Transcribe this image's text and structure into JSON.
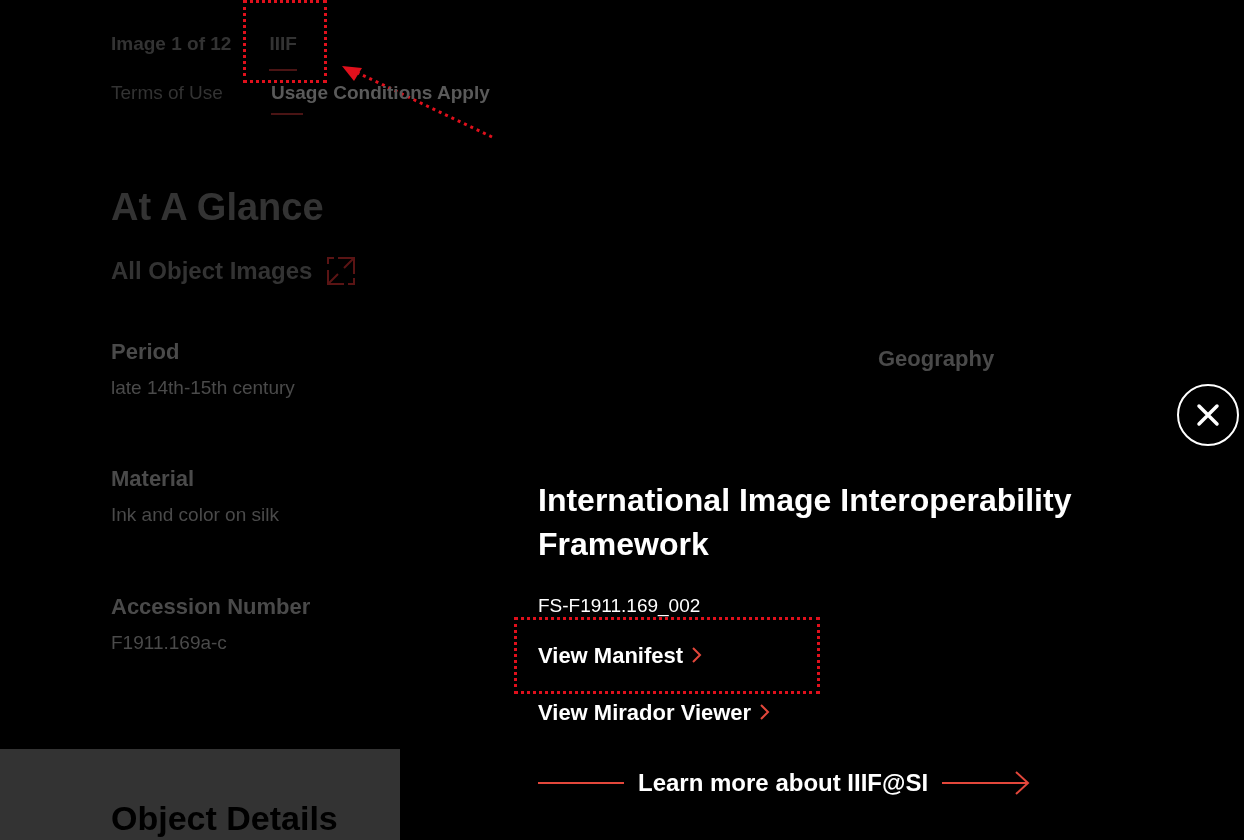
{
  "page": {
    "tabs": [
      {
        "label": "Image 1 of 12",
        "selected": false,
        "highlighted": false
      },
      {
        "label": "IIIF",
        "selected": true,
        "highlighted": true
      }
    ],
    "terms": {
      "label": "Terms of Use",
      "value": "Usage Conditions Apply"
    },
    "heading": "At A Glance",
    "all_images": "All Object Images",
    "fields": [
      {
        "label": "Period",
        "value": "late 14th-15th century"
      },
      {
        "label": "Material",
        "value": "Ink and color on silk"
      },
      {
        "label": "Accession Number",
        "value": "F1911.169a-c"
      }
    ],
    "geography_label": "Geography",
    "details_heading": "Object Details"
  },
  "modal": {
    "title": "International Image Interoperability Framework",
    "image_id": "FS-F1911.169_002",
    "links": [
      {
        "label": "View Manifest",
        "highlighted": true
      },
      {
        "label": "View Mirador Viewer",
        "highlighted": false
      }
    ],
    "learn_more": "Learn more about IIIF@SI"
  }
}
